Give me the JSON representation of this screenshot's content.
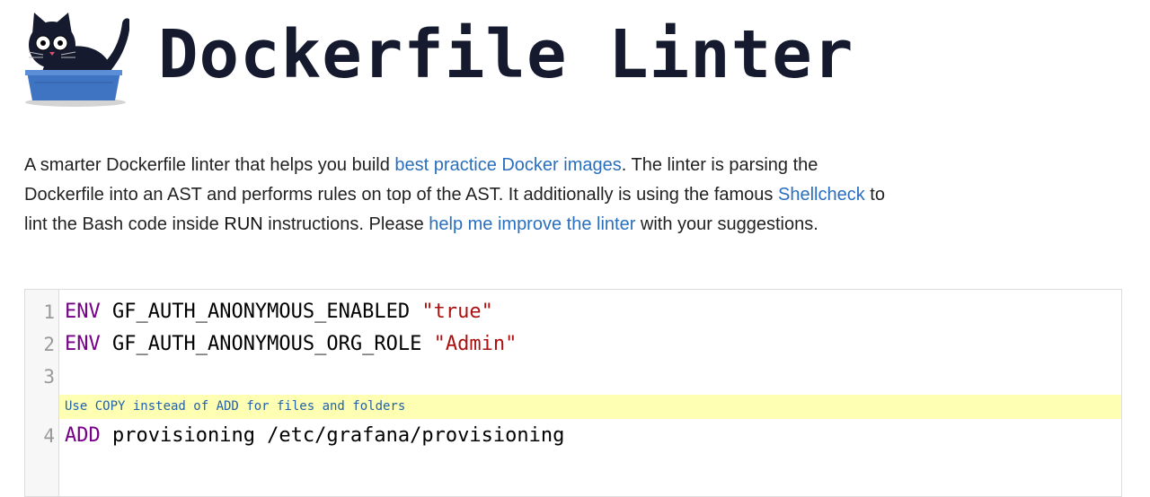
{
  "header": {
    "title": "Dockerfile Linter",
    "logo_icon": "cat-in-box-logo-icon"
  },
  "intro": {
    "text_1": "A smarter Dockerfile linter that helps you build ",
    "link_best_practice": "best practice Docker images",
    "text_2": ". The linter is parsing the Dockerfile into an AST and performs rules on top of the AST. It additionally is using the famous ",
    "link_shellcheck": "Shellcheck",
    "text_3": " to lint the Bash code inside ",
    "run_keyword": "RUN",
    "text_4": " instructions. Please ",
    "link_improve": "help me improve the linter",
    "text_5": " with your suggestions."
  },
  "editor": {
    "lines": [
      {
        "number": "1",
        "keyword": "ENV",
        "args": " GF_AUTH_ANONYMOUS_ENABLED ",
        "string": "\"true\""
      },
      {
        "number": "2",
        "keyword": "ENV",
        "args": " GF_AUTH_ANONYMOUS_ORG_ROLE ",
        "string": "\"Admin\""
      },
      {
        "number": "3",
        "keyword": "",
        "args": "",
        "string": ""
      },
      {
        "number": "4",
        "keyword": "ADD",
        "args": " provisioning /etc/grafana/provisioning",
        "string": ""
      }
    ],
    "warning": "Use COPY instead of ADD for files and folders"
  },
  "colors": {
    "title": "#161a2e",
    "link": "#2a6fbd",
    "keyword": "#770088",
    "string": "#aa1111",
    "warning_bg": "#ffffb4",
    "warning_text": "#2262a8",
    "logo_box": "#3f74c2",
    "logo_cat": "#161a2e"
  }
}
